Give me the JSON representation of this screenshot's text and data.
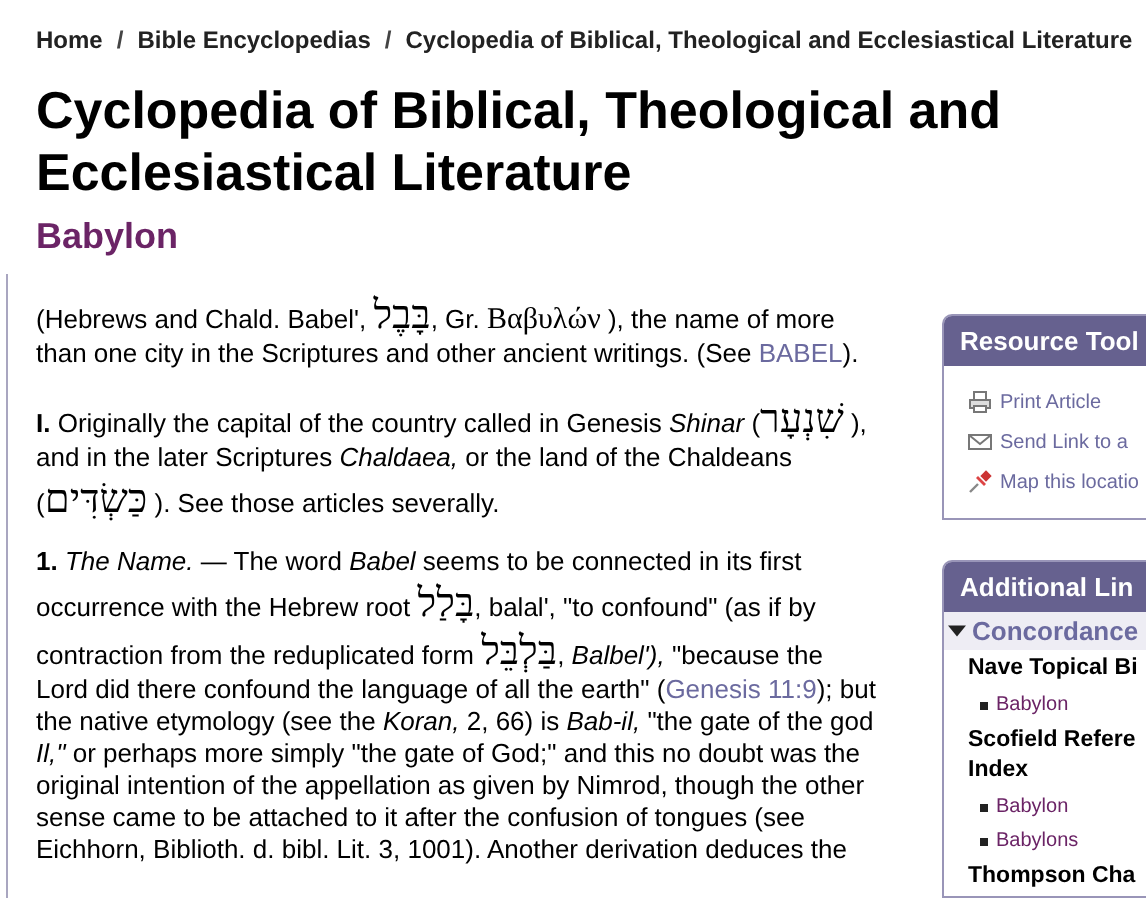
{
  "breadcrumb": {
    "separator": "/",
    "items": [
      "Home",
      "Bible Encyclopedias",
      "Cyclopedia of Biblical, Theological and Ecclesiastical Literature"
    ]
  },
  "title": "Cyclopedia of Biblical, Theological and Ecclesiastical Literature",
  "subtitle": "Babylon",
  "paragraphs": [
    [
      {
        "kind": "plain",
        "text": "(Hebrews and Chald. Babel', "
      },
      {
        "kind": "hebrew",
        "text": "בָּבֶל"
      },
      {
        "kind": "plain",
        "text": ", Gr. "
      },
      {
        "kind": "greek",
        "text": "Βαβυλών"
      },
      {
        "kind": "plain",
        "text": " ), the name of more than one city in the Scriptures and other ancient writings. (See "
      },
      {
        "kind": "link",
        "text": "BABEL"
      },
      {
        "kind": "plain",
        "text": ")."
      }
    ],
    [
      {
        "kind": "bold",
        "text": "I."
      },
      {
        "kind": "plain",
        "text": " Originally the capital of the country called in Genesis "
      },
      {
        "kind": "italic",
        "text": "Shinar"
      },
      {
        "kind": "plain",
        "text": " ("
      },
      {
        "kind": "hebrew",
        "text": "שִׁנְעָר"
      },
      {
        "kind": "plain",
        "text": " ), and in the later Scriptures "
      },
      {
        "kind": "italic",
        "text": "Chaldaea,"
      },
      {
        "kind": "plain",
        "text": " or the land of the Chaldeans ("
      },
      {
        "kind": "hebrew",
        "text": "כַּשְׂדִּים"
      },
      {
        "kind": "plain",
        "text": " ). See those articles severally."
      }
    ],
    [
      {
        "kind": "bold",
        "text": "1."
      },
      {
        "kind": "italic",
        "text": " The Name."
      },
      {
        "kind": "plain",
        "text": " — The word "
      },
      {
        "kind": "italic",
        "text": "Babel"
      },
      {
        "kind": "plain",
        "text": " seems to be connected in its first occurrence with the Hebrew root "
      },
      {
        "kind": "hebrew",
        "text": "בָּלַל"
      },
      {
        "kind": "plain",
        "text": ", balal', \"to confound\" (as if by contraction from the reduplicated form "
      },
      {
        "kind": "hebrew",
        "text": "בַּלְבֵּל"
      },
      {
        "kind": "plain",
        "text": ", "
      },
      {
        "kind": "italic",
        "text": "Balbel'),"
      },
      {
        "kind": "plain",
        "text": " \"because the Lord did there confound the language of all the earth\" ("
      },
      {
        "kind": "link",
        "text": "Genesis 11:9"
      },
      {
        "kind": "plain",
        "text": "); but the native etymology (see the "
      },
      {
        "kind": "italic",
        "text": "Koran,"
      },
      {
        "kind": "plain",
        "text": " 2, 66) is "
      },
      {
        "kind": "italic",
        "text": "Bab-il,"
      },
      {
        "kind": "plain",
        "text": " \"the gate of the god "
      },
      {
        "kind": "italic",
        "text": "Il,\""
      },
      {
        "kind": "plain",
        "text": " or perhaps more simply \"the gate of God;\" and this no doubt was the original intention of the appellation as given by Nimrod, though the other sense came to be attached to it after the confusion of tongues (see Eichhorn, Biblioth. d. bibl. Lit. 3, 1001). Another derivation deduces the"
      }
    ]
  ],
  "sidebar": {
    "resource_tools": {
      "title": "Resource Tool",
      "items": [
        {
          "kind": "print",
          "label": "Print Article"
        },
        {
          "kind": "email",
          "label": "Send Link to a"
        },
        {
          "kind": "map",
          "label": "Map this locatio"
        }
      ]
    },
    "additional_links": {
      "title": "Additional Lin",
      "section": {
        "title": "Concordance",
        "expanded": true,
        "groups": [
          {
            "title_lines": [
              "Nave Topical Bi"
            ],
            "links": [
              "Babylon"
            ]
          },
          {
            "title_lines": [
              "Scofield Refere",
              "Index"
            ],
            "links": [
              "Babylon",
              "Babylons"
            ]
          },
          {
            "title_lines": [
              "Thompson Cha"
            ]
          }
        ]
      }
    }
  }
}
